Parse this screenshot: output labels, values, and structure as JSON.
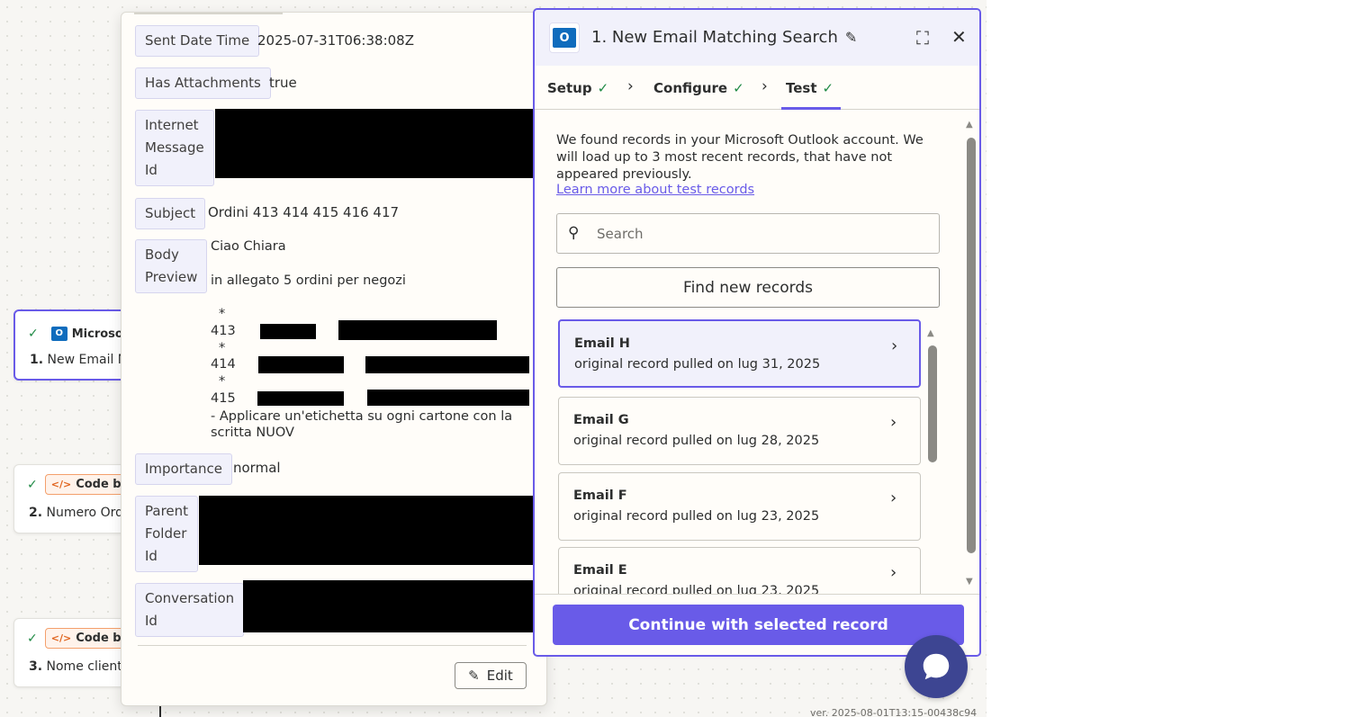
{
  "workflow": {
    "steps": [
      {
        "app": "Microsof",
        "title_num": "1.",
        "title": "New Email M"
      },
      {
        "app": "Code by",
        "title_num": "2.",
        "title": "Numero Ordi"
      },
      {
        "app": "Code by",
        "title_num": "3.",
        "title": "Nome clienti"
      }
    ]
  },
  "popup": {
    "fields": [
      {
        "label": "Sent Date Time",
        "value": "2025-07-31T06:38:08Z"
      },
      {
        "label": "Has Attachments",
        "value": "true"
      },
      {
        "label_lines": [
          "Internet",
          "Message",
          "Id"
        ],
        "value": ""
      },
      {
        "label": "Subject",
        "value": "Ordini 413 414 415 416 417"
      },
      {
        "label_lines": [
          "Body",
          "Preview"
        ],
        "value": ""
      },
      {
        "label": "Importance",
        "value": "normal"
      },
      {
        "label_lines": [
          "Parent",
          "Folder",
          "Id"
        ],
        "value": ""
      },
      {
        "label_lines": [
          "Conversation",
          "Id"
        ],
        "value": ""
      }
    ],
    "body_preview": {
      "greeting": "Ciao Chiara",
      "intro": "in allegato 5 ordini per negozi",
      "bullet": "*",
      "items": [
        "413",
        "414",
        "415"
      ],
      "note_line1": "- Applicare un'etichetta su ogni cartone con la",
      "note_line2": "scritta NUOV"
    },
    "edit_label": "Edit"
  },
  "panel": {
    "title": "1. New Email Matching Search",
    "tabs": [
      {
        "label": "Setup"
      },
      {
        "label": "Configure"
      },
      {
        "label": "Test"
      }
    ],
    "intro_text": "We found records in your Microsoft Outlook account. We will load up to 3 most recent records, that have not appeared previously.",
    "learn_more": "Learn more about test records",
    "search_placeholder": "Search",
    "find_button": "Find new records",
    "records": [
      {
        "name": "Email H",
        "desc": "original record pulled on lug 31, 2025"
      },
      {
        "name": "Email G",
        "desc": "original record pulled on lug 28, 2025"
      },
      {
        "name": "Email F",
        "desc": "original record pulled on lug 23, 2025"
      },
      {
        "name": "Email E",
        "desc": "original record pulled on lug 23, 2025"
      }
    ],
    "continue_button": "Continue with selected record"
  },
  "version": "ver. 2025-08-01T13:15-00438c94",
  "icons": {
    "outlook": "outlook-icon",
    "code": "code-icon",
    "check": "check-icon",
    "expand": "expand-icon",
    "close": "close-icon",
    "search": "search-icon",
    "chevron": "chevron-right-icon",
    "pencil": "pencil-icon",
    "chat": "chat-icon"
  },
  "colors": {
    "accent": "#695be8",
    "success": "#1f8a45",
    "outlook_blue": "#0f6cbd",
    "chat": "#3d4592"
  }
}
